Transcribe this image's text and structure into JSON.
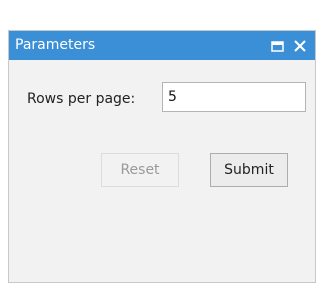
{
  "dialog": {
    "title": "Parameters",
    "maximize_icon": "maximize-icon",
    "close_icon": "close-icon"
  },
  "form": {
    "rows_per_page_label": "Rows per page:",
    "rows_per_page_value": "5"
  },
  "buttons": {
    "reset_label": "Reset",
    "reset_enabled": false,
    "submit_label": "Submit"
  },
  "colors": {
    "header": "#3b8fd6",
    "panel": "#f2f2f2"
  }
}
